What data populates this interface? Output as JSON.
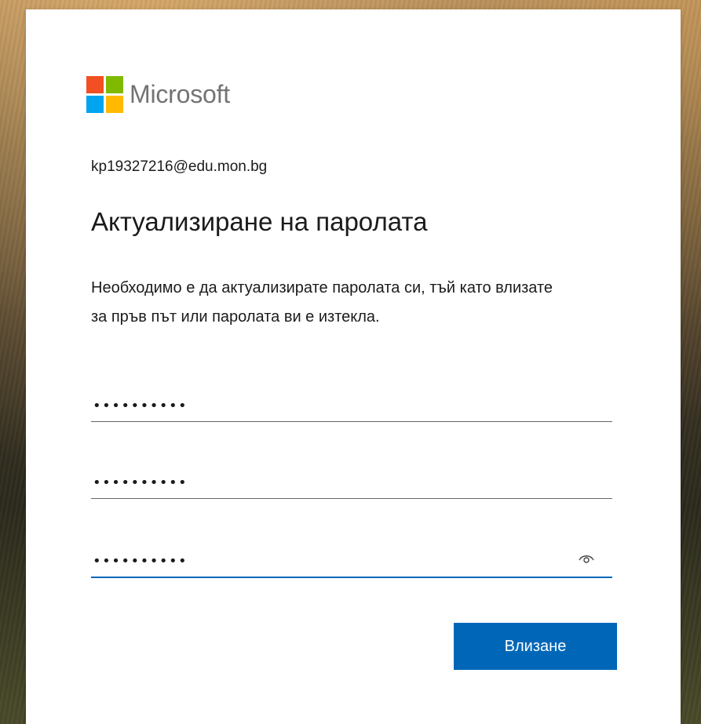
{
  "brand": {
    "name": "Microsoft",
    "colors": [
      "#f25022",
      "#7fba00",
      "#00a4ef",
      "#ffb900"
    ]
  },
  "identity": "kp19327216@edu.mon.bg",
  "title": "Актуализиране на паролата",
  "description": "Необходимо е да актуализирате паролата си, тъй като влизате за пръв път или паролата ви е изтекла.",
  "fields": [
    {
      "masked": "••••••••••"
    },
    {
      "masked": "••••••••••"
    },
    {
      "masked": "••••••••••",
      "reveal_icon": "eye-icon"
    }
  ],
  "submit_label": "Влизане"
}
